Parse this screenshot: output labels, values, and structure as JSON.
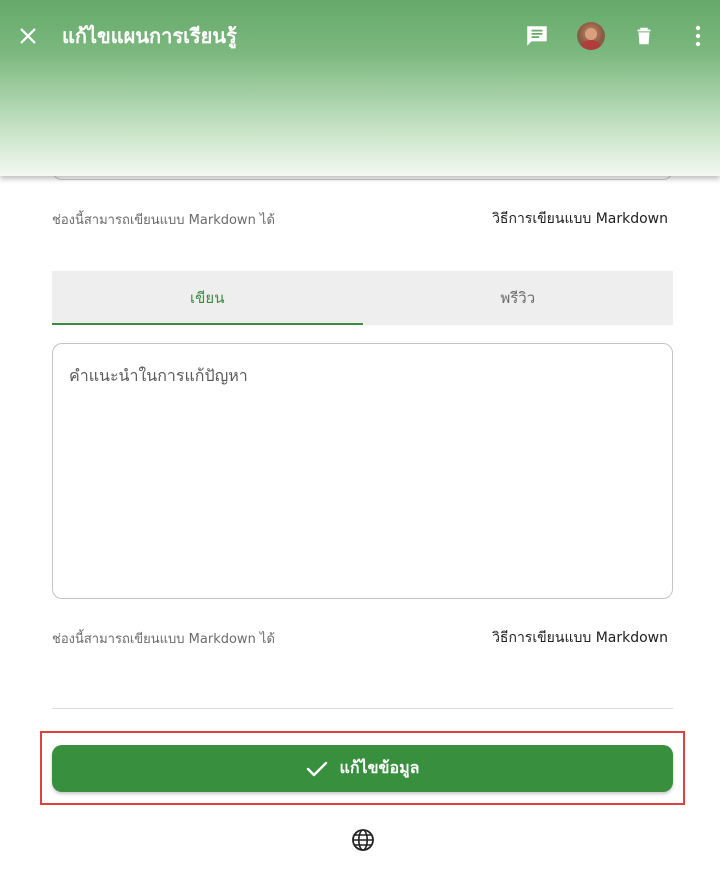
{
  "appbar": {
    "title": "แก้ไขแผนการเรียนรู้",
    "icons": [
      "close-icon",
      "comment-icon",
      "avatar",
      "delete-icon",
      "more-vert-icon"
    ]
  },
  "field_above": {
    "hint": "ช่องนี้สามารถเขียนแบบ Markdown ได้",
    "link": "วิธีการเขียนแบบ Markdown"
  },
  "tabs": {
    "write": "เขียน",
    "preview": "พรีวิว",
    "active": "write"
  },
  "editor": {
    "value": "",
    "placeholder": "คำแนะนำในการแก้ปัญหา"
  },
  "field_below": {
    "hint": "ช่องนี้สามารถเขียนแบบ Markdown ได้",
    "link": "วิธีการเขียนแบบ Markdown"
  },
  "submit": {
    "label": "แก้ไขข้อมูล",
    "icon": "check-icon"
  },
  "footer": {
    "icon": "globe-icon"
  },
  "colors": {
    "primary": "#38903e",
    "tab_active": "#3c8c42",
    "highlight": "#e0403f"
  }
}
